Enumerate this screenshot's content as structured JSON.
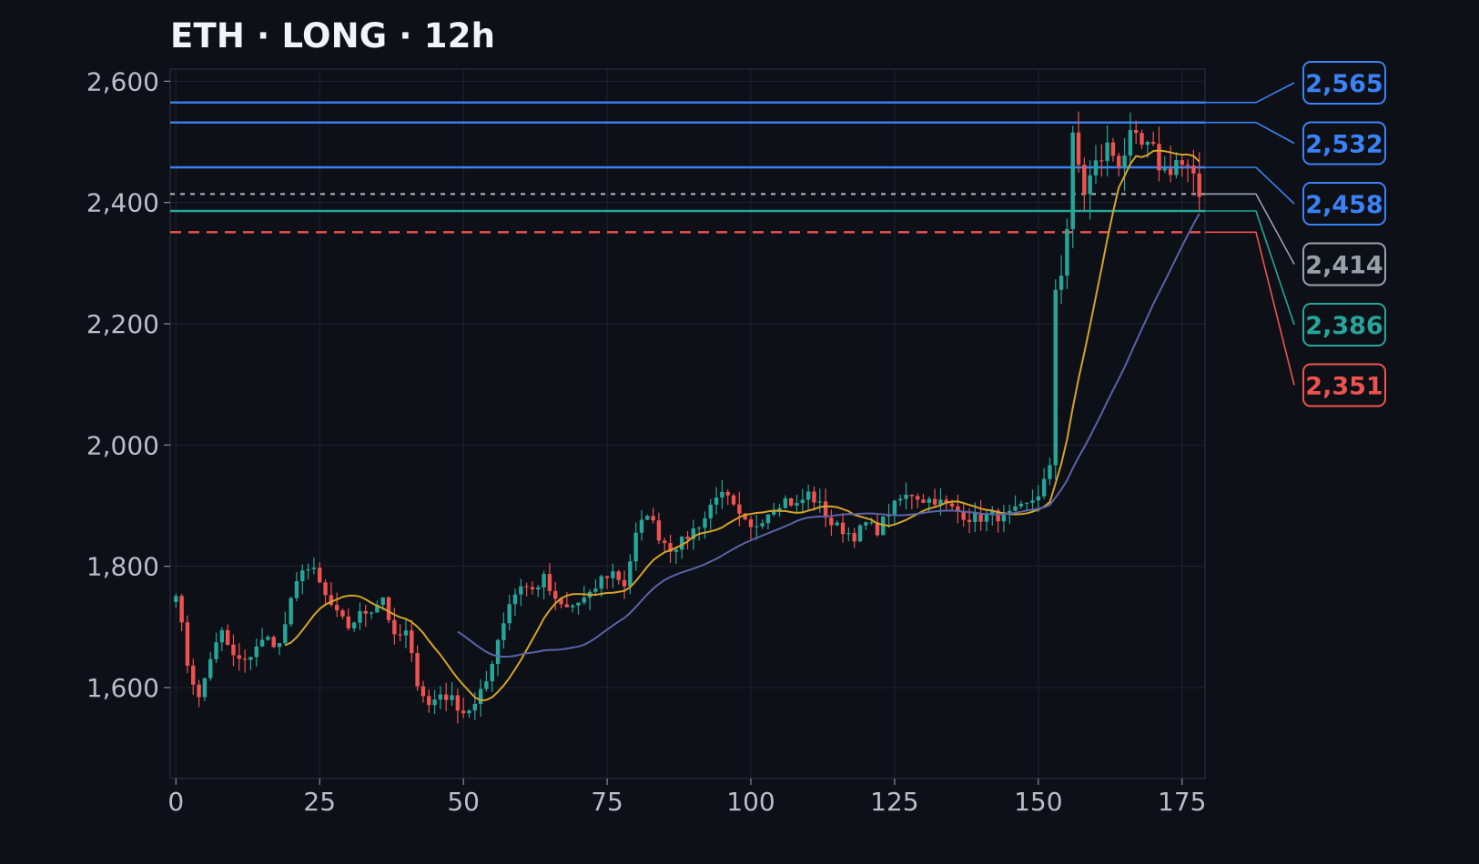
{
  "title": "ETH · LONG · 12h",
  "chart_data": {
    "type": "candlestick",
    "title": "ETH · LONG · 12h",
    "xlabel": "",
    "ylabel": "",
    "xlim": [
      -1,
      179
    ],
    "ylim": [
      1450,
      2620
    ],
    "x_ticks": [
      0,
      25,
      50,
      75,
      100,
      125,
      150,
      175
    ],
    "x_tick_labels": [
      "0",
      "25",
      "50",
      "75",
      "100",
      "125",
      "150",
      "175"
    ],
    "y_ticks": [
      1600,
      1800,
      2000,
      2200,
      2400,
      2600
    ],
    "y_tick_labels": [
      "1,600",
      "1,800",
      "2,000",
      "2,200",
      "2,400",
      "2,600"
    ],
    "grid": true,
    "colors": {
      "up": "#26a69a",
      "down": "#ef5350",
      "ma_fast": "#d4a42a",
      "ma_slow": "#5b63a8",
      "background": "#0d1017",
      "grid": "#1e232c"
    },
    "close_anchors": [
      [
        0,
        1760
      ],
      [
        2,
        1640
      ],
      [
        4,
        1580
      ],
      [
        6,
        1650
      ],
      [
        8,
        1690
      ],
      [
        10,
        1650
      ],
      [
        12,
        1640
      ],
      [
        14,
        1670
      ],
      [
        16,
        1680
      ],
      [
        18,
        1670
      ],
      [
        20,
        1740
      ],
      [
        22,
        1800
      ],
      [
        24,
        1790
      ],
      [
        26,
        1750
      ],
      [
        28,
        1720
      ],
      [
        30,
        1700
      ],
      [
        32,
        1720
      ],
      [
        34,
        1730
      ],
      [
        36,
        1750
      ],
      [
        38,
        1680
      ],
      [
        40,
        1690
      ],
      [
        42,
        1610
      ],
      [
        44,
        1570
      ],
      [
        46,
        1590
      ],
      [
        48,
        1580
      ],
      [
        50,
        1560
      ],
      [
        52,
        1570
      ],
      [
        54,
        1610
      ],
      [
        56,
        1680
      ],
      [
        58,
        1740
      ],
      [
        60,
        1770
      ],
      [
        62,
        1760
      ],
      [
        64,
        1780
      ],
      [
        66,
        1740
      ],
      [
        68,
        1730
      ],
      [
        70,
        1740
      ],
      [
        72,
        1750
      ],
      [
        74,
        1780
      ],
      [
        76,
        1790
      ],
      [
        78,
        1770
      ],
      [
        80,
        1850
      ],
      [
        82,
        1890
      ],
      [
        84,
        1850
      ],
      [
        86,
        1830
      ],
      [
        88,
        1840
      ],
      [
        90,
        1860
      ],
      [
        92,
        1880
      ],
      [
        94,
        1920
      ],
      [
        96,
        1910
      ],
      [
        98,
        1880
      ],
      [
        100,
        1860
      ],
      [
        102,
        1880
      ],
      [
        104,
        1900
      ],
      [
        106,
        1910
      ],
      [
        108,
        1900
      ],
      [
        110,
        1920
      ],
      [
        112,
        1900
      ],
      [
        114,
        1870
      ],
      [
        116,
        1860
      ],
      [
        118,
        1850
      ],
      [
        120,
        1870
      ],
      [
        122,
        1860
      ],
      [
        124,
        1890
      ],
      [
        126,
        1910
      ],
      [
        128,
        1920
      ],
      [
        130,
        1910
      ],
      [
        132,
        1910
      ],
      [
        134,
        1900
      ],
      [
        136,
        1890
      ],
      [
        138,
        1880
      ],
      [
        140,
        1880
      ],
      [
        142,
        1885
      ],
      [
        144,
        1880
      ],
      [
        146,
        1890
      ],
      [
        148,
        1900
      ],
      [
        150,
        1920
      ],
      [
        152,
        1960
      ],
      [
        153,
        2260
      ],
      [
        154,
        2290
      ],
      [
        155,
        2360
      ],
      [
        156,
        2500
      ],
      [
        158,
        2420
      ],
      [
        160,
        2460
      ],
      [
        162,
        2490
      ],
      [
        164,
        2470
      ],
      [
        166,
        2500
      ],
      [
        168,
        2490
      ],
      [
        170,
        2480
      ],
      [
        172,
        2450
      ],
      [
        174,
        2470
      ],
      [
        176,
        2450
      ],
      [
        178,
        2410
      ]
    ],
    "moving_averages": [
      {
        "name": "",
        "color": "#d4a42a",
        "start": 19
      },
      {
        "name": "",
        "color": "#5b63a8",
        "start": 49
      }
    ],
    "levels": [
      {
        "value": 2565,
        "label": "2,565",
        "color": "#3b82f6",
        "style": "solid"
      },
      {
        "value": 2532,
        "label": "2,532",
        "color": "#3b82f6",
        "style": "solid"
      },
      {
        "value": 2458,
        "label": "2,458",
        "color": "#3b82f6",
        "style": "solid"
      },
      {
        "value": 2414,
        "label": "2,414",
        "color": "#9aa1ab",
        "style": "dotted"
      },
      {
        "value": 2386,
        "label": "2,386",
        "color": "#26a69a",
        "style": "solid"
      },
      {
        "value": 2351,
        "label": "2,351",
        "color": "#ef5350",
        "style": "dashed"
      }
    ]
  }
}
